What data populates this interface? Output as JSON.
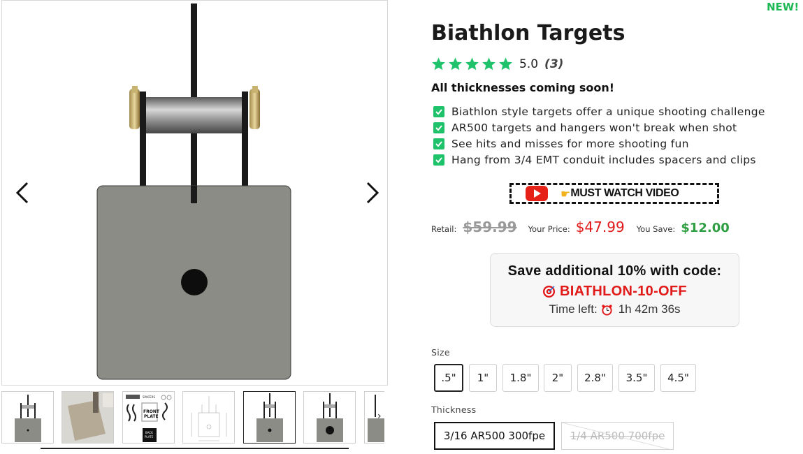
{
  "badge": "NEW!",
  "product": {
    "title": "Biathlon Targets",
    "rating_value": "5.0",
    "rating_count": "(3)",
    "stars": 5,
    "announcement": "All thicknesses coming soon!",
    "features": [
      "Biathlon style targets offer a unique shooting challenge",
      "AR500 targets and hangers won't break when shot",
      "See hits and misses for more shooting fun",
      "Hang from 3/4 EMT conduit includes spacers and clips"
    ]
  },
  "video": {
    "label": "MUST WATCH VIDEO",
    "icon": "youtube-play-icon",
    "pointer_icon": "pointing-hand-icon"
  },
  "pricing": {
    "retail_label": "Retail:",
    "retail": "$59.99",
    "your_price_label": "Your Price:",
    "your_price": "$47.99",
    "you_save_label": "You Save:",
    "you_save": "$12.00"
  },
  "promo": {
    "headline": "Save additional 10% with code:",
    "code": "BIATHLON-10-OFF",
    "timer_label": "Time left:",
    "timer_value": "1h 42m 36s"
  },
  "options": {
    "size_label": "Size",
    "sizes": [
      ".5\"",
      "1\"",
      "1.8\"",
      "2\"",
      "2.8\"",
      "3.5\"",
      "4.5\""
    ],
    "selected_size": ".5\"",
    "thickness_label": "Thickness",
    "thicknesses": [
      "3/16 AR500 300fpe",
      "1/4 AR500 700fpe"
    ],
    "selected_thickness": "3/16 AR500 300fpe",
    "unavailable_thickness": "1/4 AR500 700fpe"
  },
  "gallery": {
    "thumbnail_count": 7,
    "selected_thumbnail": 5
  },
  "colors": {
    "accent_green": "#1db954",
    "price_red": "#e11919",
    "savings_green": "#2ea043",
    "plate_gray": "#8c8c86"
  }
}
